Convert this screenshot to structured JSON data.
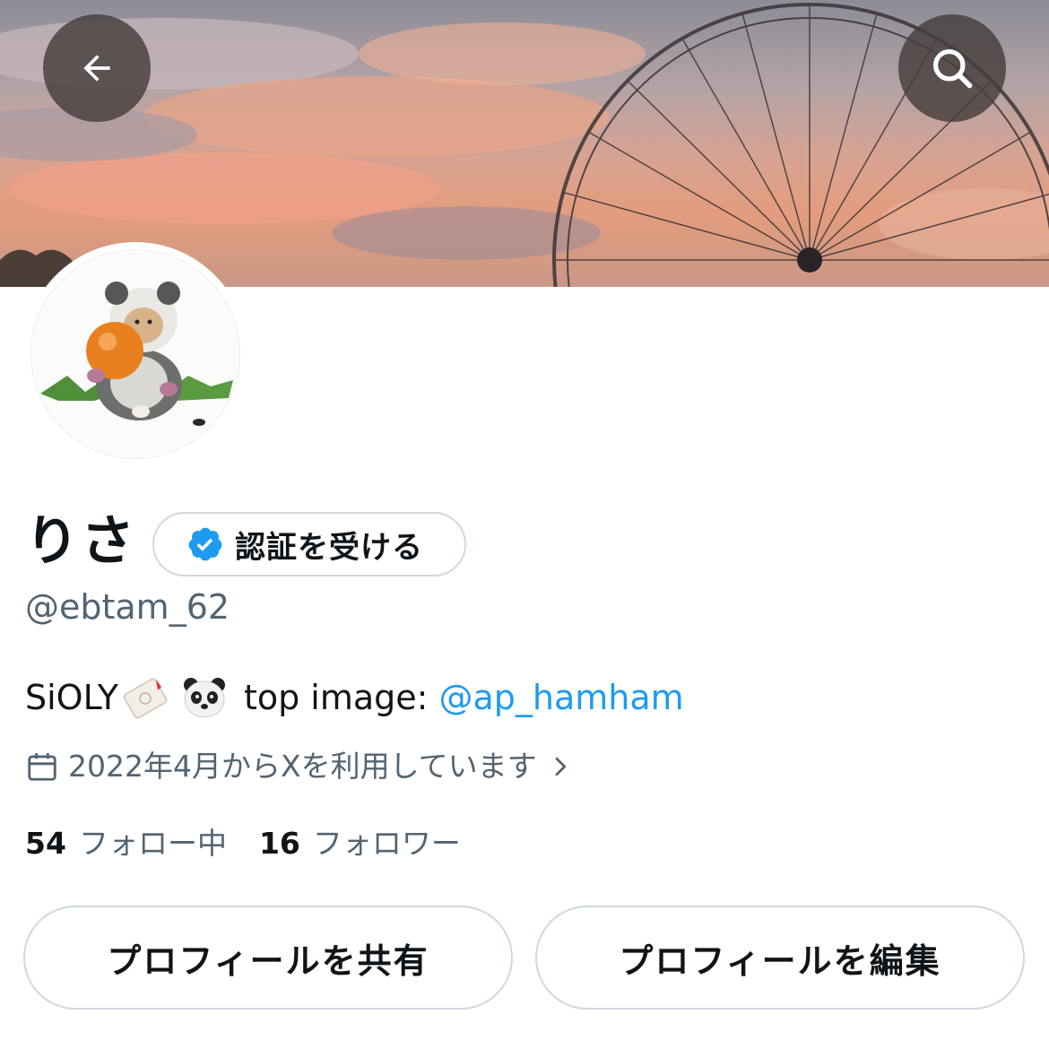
{
  "header": {
    "back_icon": "arrow-left-icon",
    "search_icon": "search-icon"
  },
  "profile": {
    "display_name": "りさ",
    "verify_button_label": "認証を受ける",
    "verify_icon": "verified-badge-icon",
    "handle": "@ebtam_62",
    "bio": {
      "text_start": "SiOLY",
      "emojis": [
        "tag-emoji",
        "panda-emoji"
      ],
      "text_mid": "top image:",
      "mention": "@ap_hamham"
    },
    "joined": {
      "icon": "calendar-icon",
      "text": "2022年4月からXを利用しています",
      "chevron_icon": "chevron-right-icon"
    },
    "stats": {
      "following_count": "54",
      "following_label": "フォロー中",
      "followers_count": "16",
      "followers_label": "フォロワー"
    }
  },
  "actions": {
    "share_label": "プロフィールを共有",
    "edit_label": "プロフィールを編集"
  },
  "colors": {
    "accent": "#1d9bf0",
    "secondary_text": "#536471",
    "border": "#cfd9de"
  }
}
